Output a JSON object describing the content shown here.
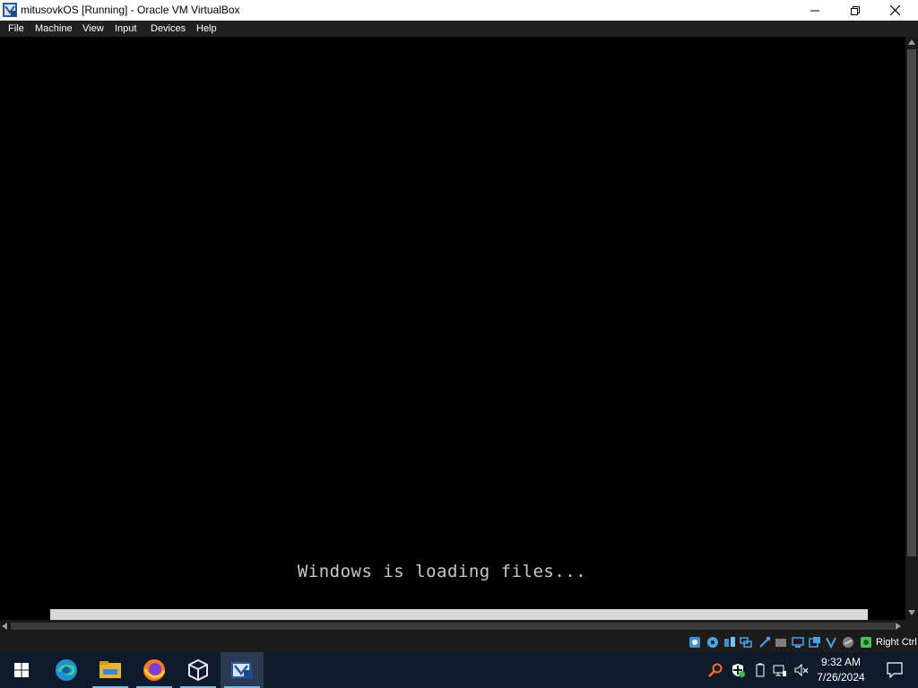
{
  "window": {
    "title": "mitusovkOS [Running] - Oracle VM VirtualBox",
    "controls": [
      "minimize",
      "restore",
      "close"
    ]
  },
  "menu": {
    "items": [
      "File",
      "Machine",
      "View",
      "Input",
      "Devices",
      "Help"
    ]
  },
  "vm": {
    "boot_message": "Windows is loading files..."
  },
  "status_bar": {
    "icons": [
      "hard-disk-icon",
      "optical-drive-icon",
      "audio-icon",
      "network-icon",
      "usb-icon",
      "shared-folders-icon",
      "display-icon",
      "video-capture-icon",
      "recording-icon",
      "cpu-icon",
      "mouse-integration-icon",
      "keyboard-icon"
    ],
    "host_key": "Right Ctrl"
  },
  "taskbar": {
    "apps": [
      "start-icon",
      "edge-icon",
      "file-explorer-icon",
      "firefox-icon",
      "virtualbox-icon",
      "virtualbox-vm-icon"
    ],
    "tray_icons": [
      "search-tray-icon",
      "defender-icon",
      "battery-icon",
      "network-icon",
      "volume-muted-icon"
    ],
    "time": "9:32 AM",
    "date": "7/26/2024"
  },
  "colors": {
    "titlebar_bg": "#ffffff",
    "menubar_bg": "#202020",
    "vm_bg": "#000000",
    "taskbar_bg": "#0f1a2b",
    "taskbar_indicator": "#76b9ed"
  }
}
